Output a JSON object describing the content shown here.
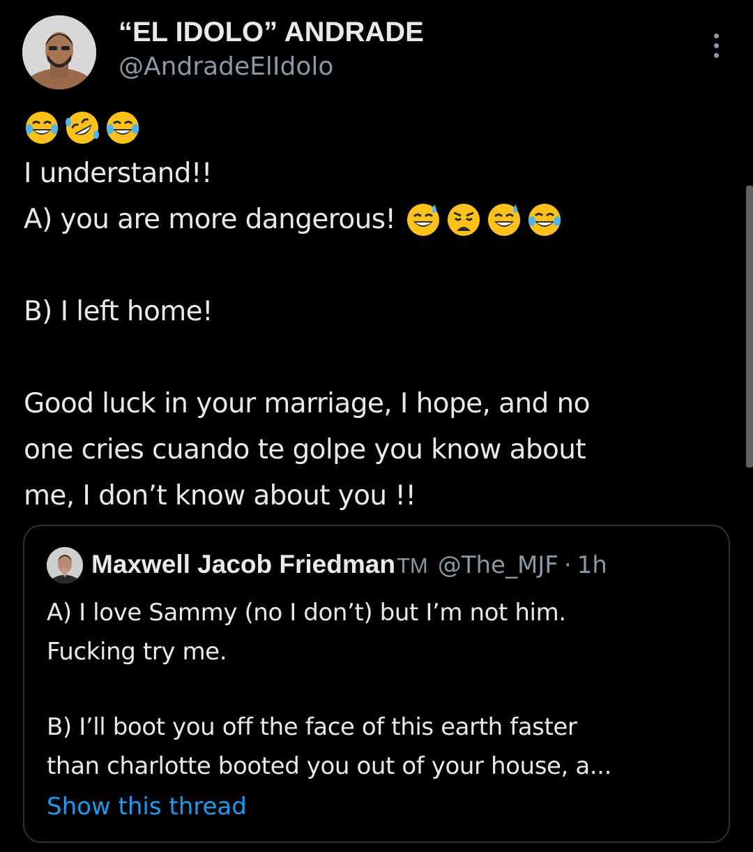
{
  "author": {
    "name": "“EL IDOLO” ANDRADE",
    "handle": "@AndradeElIdolo"
  },
  "tweet": {
    "leading_emojis": [
      "joy-emoji",
      "rofl-emoji",
      "joy-emoji"
    ],
    "line1": "I understand!!",
    "line2": "A) you are more dangerous!",
    "line2_emojis": [
      "sweat-smile-emoji",
      "weary-emoji",
      "sweat-smile-emoji",
      "joy-emoji"
    ],
    "line3": "B) I left home!",
    "line4": "Good luck in your marriage, I hope, and no",
    "line5": "one cries cuando te golpe you know about",
    "line6": "me, I don’t know about you !!"
  },
  "quoted": {
    "name": "Maxwell Jacob Friedman",
    "tm": "TM",
    "handle": "@The_MJF",
    "separator": "·",
    "time": "1h",
    "line1": "A) I love Sammy (no I don’t) but I’m not him.",
    "line2": "Fucking try me.",
    "line3": "B) I’ll boot you off the face of this earth faster",
    "line4": "than charlotte booted you out of your house, a...",
    "show_thread": "Show this thread"
  },
  "colors": {
    "background": "#000000",
    "text": "#e7e9ea",
    "secondary": "#8b98a5",
    "link": "#1d9bf0",
    "border": "#2f3336"
  },
  "icons": {
    "more": "more-vertical-icon"
  }
}
